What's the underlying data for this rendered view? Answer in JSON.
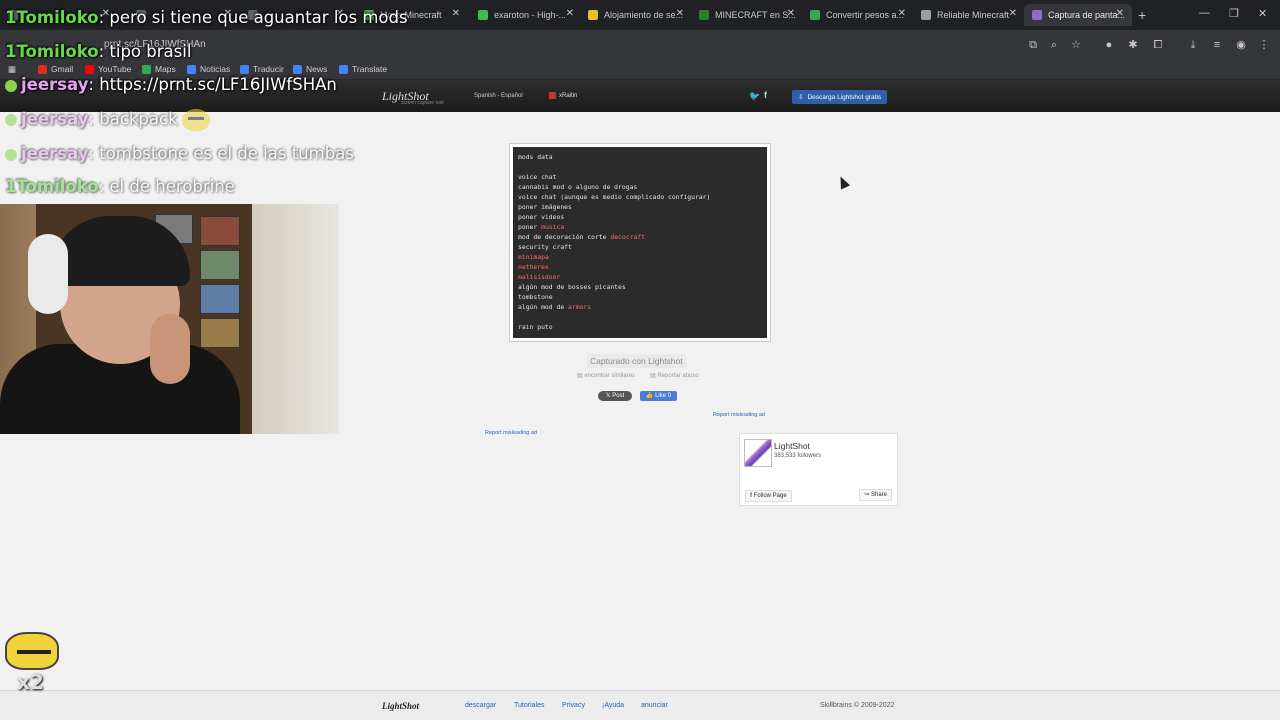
{
  "browser": {
    "tabs": [
      {
        "label": "",
        "active": false,
        "color": "#5f6368"
      },
      {
        "label": "",
        "active": false,
        "color": "#5f6368"
      },
      {
        "label": "",
        "active": false,
        "color": "#5f6368"
      },
      {
        "label": "Mods Minecraft",
        "active": false,
        "color": "#4caf50"
      },
      {
        "label": "exaroton - High-...",
        "active": false,
        "color": "#3fb950"
      },
      {
        "label": "Alojamiento de se...",
        "active": false,
        "color": "#e4c11b"
      },
      {
        "label": "MINECRAFT en S...",
        "active": false,
        "color": "#2e7d32"
      },
      {
        "label": "Convertir pesos a...",
        "active": false,
        "color": "#34a853"
      },
      {
        "label": "Reliable Minecraft",
        "active": false,
        "color": "#9aa0a6"
      },
      {
        "label": "Captura de panta...",
        "active": true,
        "color": "#8e6cc8"
      }
    ],
    "url": "prnt.sc/LF16JIWfSHAn",
    "bookmarks": [
      {
        "label": "Gmail",
        "color": "#d93025"
      },
      {
        "label": "YouTube",
        "color": "#ff0000"
      },
      {
        "label": "Maps",
        "color": "#34a853"
      },
      {
        "label": "Noticias",
        "color": "#4285f4"
      },
      {
        "label": "Traducir",
        "color": "#4285f4"
      },
      {
        "label": "News",
        "color": "#4285f4"
      },
      {
        "label": "Translate",
        "color": "#4285f4"
      }
    ]
  },
  "site": {
    "logo": "LightShot",
    "slogan": "screen capture tool",
    "language": "Spanish - Español",
    "user": "xRaitin",
    "download_button": "Descarga Lightshot gratis",
    "screenshot_lines": [
      [
        {
          "t": "mods data"
        }
      ],
      [
        {
          "t": ""
        }
      ],
      [
        {
          "t": "voice chat"
        }
      ],
      [
        {
          "t": "cannabis mod o alguno de drogas"
        }
      ],
      [
        {
          "t": "voice chat (aunque es medio complicado configurar)"
        }
      ],
      [
        {
          "t": "poner imágenes"
        }
      ],
      [
        {
          "t": "poner videos"
        }
      ],
      [
        {
          "t": "poner "
        },
        {
          "t": "musica",
          "red": true
        }
      ],
      [
        {
          "t": "mod de decoración corte "
        },
        {
          "t": "decocraft",
          "red": true
        }
      ],
      [
        {
          "t": "security craft"
        }
      ],
      [
        {
          "t": "minimapa",
          "red": true
        }
      ],
      [
        {
          "t": "netherex",
          "red": true
        }
      ],
      [
        {
          "t": "malisisdoor",
          "red": true
        }
      ],
      [
        {
          "t": "algún mod de bosses picantes"
        }
      ],
      [
        {
          "t": "tombstone"
        }
      ],
      [
        {
          "t": "algún mod de "
        },
        {
          "t": "armors",
          "red": true
        }
      ],
      [
        {
          "t": ""
        }
      ],
      [
        {
          "t": "rain puto"
        }
      ]
    ],
    "captured_label": "Capturado con Lightshot",
    "find_similar": "encontrar similares",
    "report_abuse": "Reportar abuso",
    "tw_post": "Post",
    "fb_like": "Like 0",
    "report_ad": "Report misleading ad",
    "fb_box": {
      "name": "LightShot",
      "followers": "383,533 followers",
      "follow": "Follow Page",
      "share": "Share"
    },
    "footer": {
      "logo": "LightShot",
      "links": [
        "descargar",
        "Tutoriales",
        "Privacy",
        "¡Ayuda",
        "anunciar"
      ],
      "copyright": "Skillbrains © 2009-2022"
    }
  },
  "stream": {
    "chat": [
      {
        "user": "1Tomiloko",
        "sep": ":",
        "msg": " pero si tiene que aguantar los mods",
        "user_color": "green"
      },
      {
        "user": "1Tomiloko",
        "sep": ":",
        "msg": " tipo brasil",
        "user_color": "green"
      },
      {
        "user": "jeersay",
        "sep": ":",
        "msg": " https://prnt.sc/LF16JIWfSHAn",
        "user_color": "pink"
      },
      {
        "user": "jeersay",
        "sep": ":",
        "msg": " backpack",
        "user_color": "pink"
      },
      {
        "user": "jeersay",
        "sep": ":",
        "msg": " tombstone es el de las tumbas",
        "user_color": "pink"
      },
      {
        "user": "1Tomiloko",
        "sep": ":",
        "msg": " el de herobrine",
        "user_color": "green"
      }
    ],
    "alert_multiplier": "x2"
  }
}
